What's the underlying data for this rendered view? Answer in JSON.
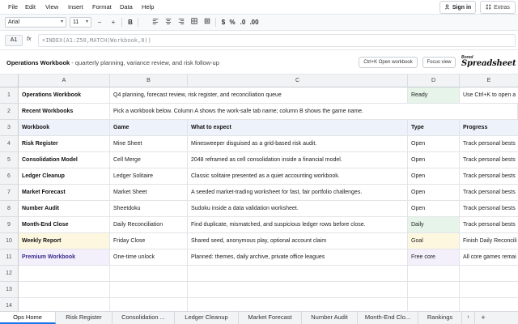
{
  "menu": [
    "File",
    "Edit",
    "View",
    "Insert",
    "Format",
    "Data",
    "Help"
  ],
  "account": {
    "signin_label": "Sign in",
    "extras_label": "Extras"
  },
  "toolbar": {
    "font": "Arial",
    "font_size": "11",
    "minus": "−",
    "plus": "+",
    "bold": "B",
    "currency": "$",
    "percent": "%",
    "decimal_less": ".0",
    "decimal_more": ".00"
  },
  "formula_bar": {
    "cell_ref": "A1",
    "fx": "fx",
    "formula": "=INDEX(A1:Z50,MATCH(Workbook,0))"
  },
  "workbook": {
    "title": "Operations Workbook",
    "subtitle": " - quarterly planning, variance review, and risk follow-up",
    "open_button": "Ctrl+K Open workbook",
    "focus_button": "Focus view",
    "logo_small": "Bored",
    "logo_big": "Spreadsheet"
  },
  "columns": [
    "A",
    "B",
    "C",
    "D",
    "E"
  ],
  "rows": [
    {
      "n": "1",
      "a": "Operations Workbook",
      "b": "Q4 planning, forecast review, risk register, and reconciliation queue",
      "c": "",
      "d": "Ready",
      "e": "Use Ctrl+K to open a"
    },
    {
      "n": "2",
      "a": "Recent Workbooks",
      "b": "Pick a workbook below. Column A shows the work-safe tab name; column B shows the game name.",
      "c": "",
      "d": "",
      "e": ""
    },
    {
      "n": "3",
      "a": "Workbook",
      "b": "Game",
      "c": "What to expect",
      "d": "Type",
      "e": "Progress"
    },
    {
      "n": "4",
      "a": "Risk Register",
      "b": "Mine Sheet",
      "c": "Minesweeper disguised as a grid-based risk audit.",
      "d": "Open",
      "e": "Track personal bests"
    },
    {
      "n": "5",
      "a": "Consolidation Model",
      "b": "Cell Merge",
      "c": "2048 reframed as cell consolidation inside a financial model.",
      "d": "Open",
      "e": "Track personal bests"
    },
    {
      "n": "6",
      "a": "Ledger Cleanup",
      "b": "Ledger Solitaire",
      "c": "Classic solitaire presented as a quiet accounting workbook.",
      "d": "Open",
      "e": "Track personal bests"
    },
    {
      "n": "7",
      "a": "Market Forecast",
      "b": "Market Sheet",
      "c": "A seeded market-trading worksheet for fast, fair portfolio challenges.",
      "d": "Open",
      "e": "Track personal bests"
    },
    {
      "n": "8",
      "a": "Number Audit",
      "b": "Sheetdoku",
      "c": "Sudoku inside a data validation worksheet.",
      "d": "Open",
      "e": "Track personal bests"
    },
    {
      "n": "9",
      "a": "Month-End Close",
      "b": "Daily Reconciliation",
      "c": "Find duplicate, mismatched, and suspicious ledger rows before close.",
      "d": "Daily",
      "e": "Track personal bests"
    },
    {
      "n": "10",
      "a": "Weekly Report",
      "b": "Friday Close",
      "c": "Shared seed, anonymous play, optional account claim",
      "d": "Goal",
      "e": "Finish Daily Reconcili"
    },
    {
      "n": "11",
      "a": "Premium Workbook",
      "b": "One-time unlock",
      "c": "Planned: themes, daily archive, private office leagues",
      "d": "Free core",
      "e": "All core games remai"
    },
    {
      "n": "12",
      "a": "",
      "b": "",
      "c": "",
      "d": "",
      "e": ""
    },
    {
      "n": "13",
      "a": "",
      "b": "",
      "c": "",
      "d": "",
      "e": ""
    },
    {
      "n": "14",
      "a": "",
      "b": "",
      "c": "",
      "d": "",
      "e": ""
    }
  ],
  "tabs": [
    "Ops Home",
    "Risk Register",
    "Consolidation ...",
    "Ledger Cleanup",
    "Market Forecast",
    "Number Audit",
    "Month-End Clo...",
    "Rankings"
  ],
  "tab_nav": {
    "next": "›",
    "add": "+"
  },
  "colors": {
    "ready_bg": "#e6f4ea",
    "daily_bg": "#e6f4ea",
    "goal_bg": "#fef7e0",
    "premium_bg": "#f3f0fc",
    "header_bg": "#eef3fb",
    "accent": "#1a73e8"
  }
}
